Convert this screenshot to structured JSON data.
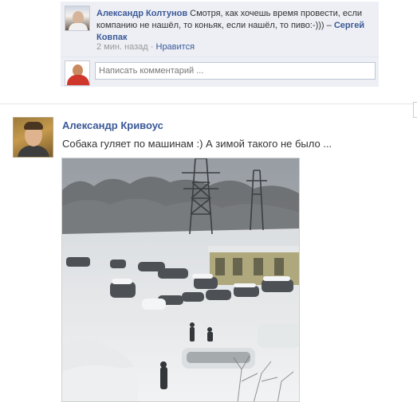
{
  "comment": {
    "author": "Александр Колтунов",
    "text": "Смотря, как хочешь время провести, если компанию не нашёл, то коньяк, если нашёл, то пиво:-))) – ",
    "mention": "Сергей Ковпак",
    "time": "2 мин. назад",
    "separator": " · ",
    "like_label": "Нравится"
  },
  "compose": {
    "placeholder": "Написать комментарий ..."
  },
  "post": {
    "author": "Александр Кривоус",
    "text": "Собака гуляет по машинам :) А зимой такого не было ..."
  },
  "colors": {
    "link": "#3b5998",
    "comment_bg": "#edeff4",
    "meta": "#999999"
  }
}
